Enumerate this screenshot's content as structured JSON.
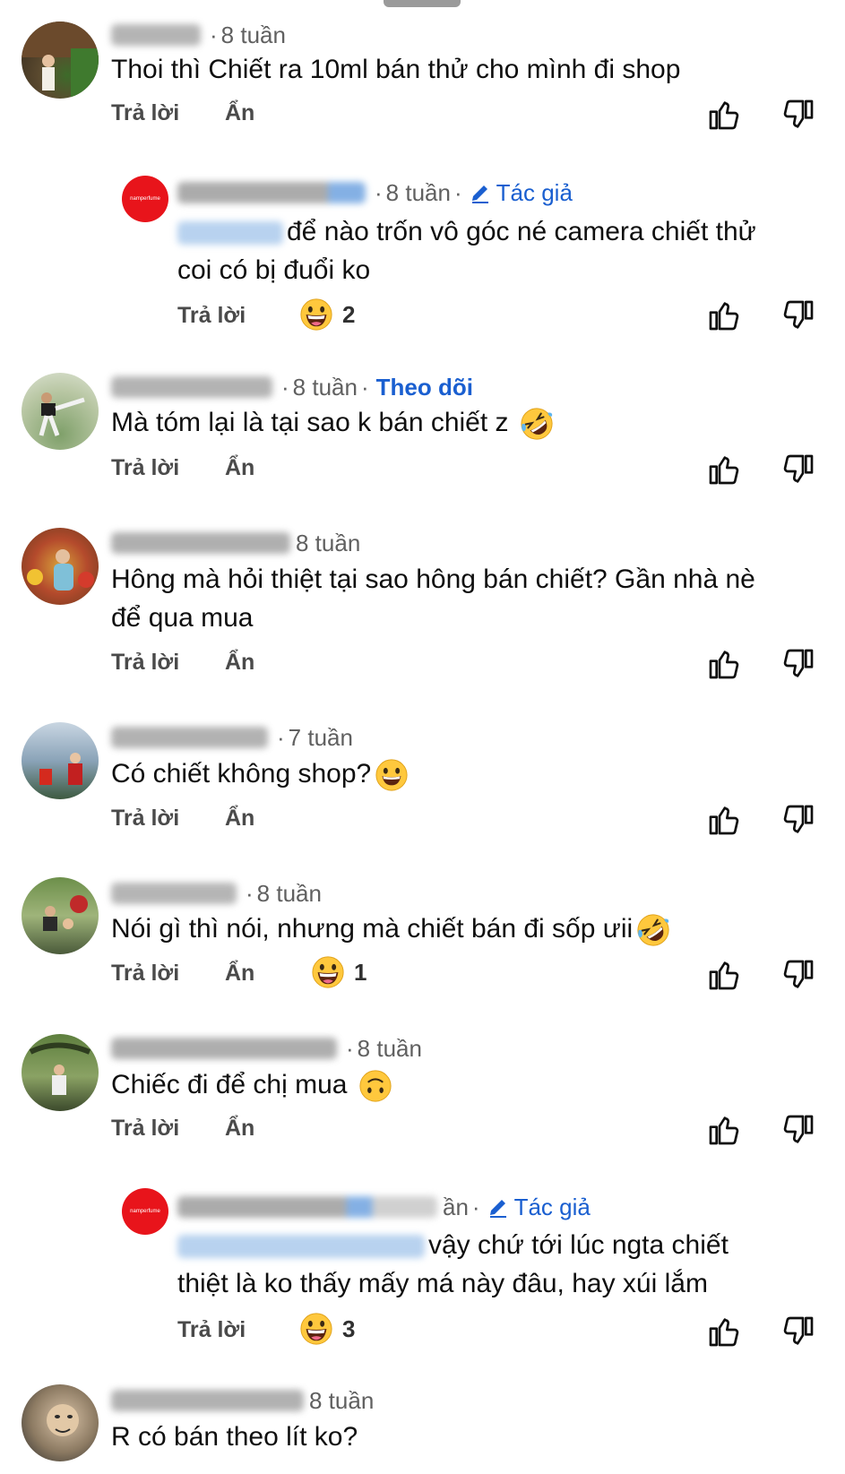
{
  "comments": [
    {
      "time": "8 tuần",
      "text": "Thoi thì Chiết ra 10ml bán thử cho mình đi shop",
      "reply": "Trả lời",
      "hide": "Ẩn"
    },
    {
      "time": "8 tuần",
      "author_badge": "Tác giả",
      "text": "để nào trốn vô góc né camera chiết thử coi có bị đuổi ko",
      "line1": "để nào trốn vô góc né camera chiết thử",
      "line2": "coi có bị đuổi ko",
      "reply": "Trả lời",
      "reaction_count": "2",
      "avatar_text": "namperfume"
    },
    {
      "time": "8 tuần",
      "follow": "Theo dõi",
      "text": "Mà tóm lại là tại sao k bán chiết z",
      "reply": "Trả lời",
      "hide": "Ẩn"
    },
    {
      "time": "8 tuần",
      "line1": "Hông mà hỏi thiệt tại sao hông bán chiết? Gần nhà nè",
      "line2": "để qua mua",
      "reply": "Trả lời",
      "hide": "Ẩn"
    },
    {
      "time": "7 tuần",
      "text": "Có chiết không shop?",
      "reply": "Trả lời",
      "hide": "Ẩn"
    },
    {
      "time": "8 tuần",
      "text": "Nói gì thì nói, nhưng mà chiết bán đi sốp ưii",
      "reply": "Trả lời",
      "hide": "Ẩn",
      "reaction_count": "1"
    },
    {
      "time": "8 tuần",
      "text": "Chiếc đi để chị mua",
      "reply": "Trả lời",
      "hide": "Ẩn"
    },
    {
      "time_partial": "ần",
      "author_badge": "Tác giả",
      "line1": "vậy chứ tới lúc ngta chiết",
      "line2": "thiệt là ko thấy mấy má này đâu, hay xúi lắm",
      "reply": "Trả lời",
      "reaction_count": "3",
      "avatar_text": "namperfume"
    },
    {
      "time": "8 tuần",
      "text": "R có bán theo lít ko?"
    }
  ],
  "colors": {
    "link": "#1a5fd0",
    "meta": "#606060",
    "text": "#0f0f0f",
    "brand_red": "#e8141b"
  },
  "icons": [
    "thumb-up-icon",
    "thumb-down-icon",
    "pencil-icon",
    "grin-emoji",
    "rofl-emoji",
    "smile-emoji",
    "upside-down-emoji"
  ]
}
